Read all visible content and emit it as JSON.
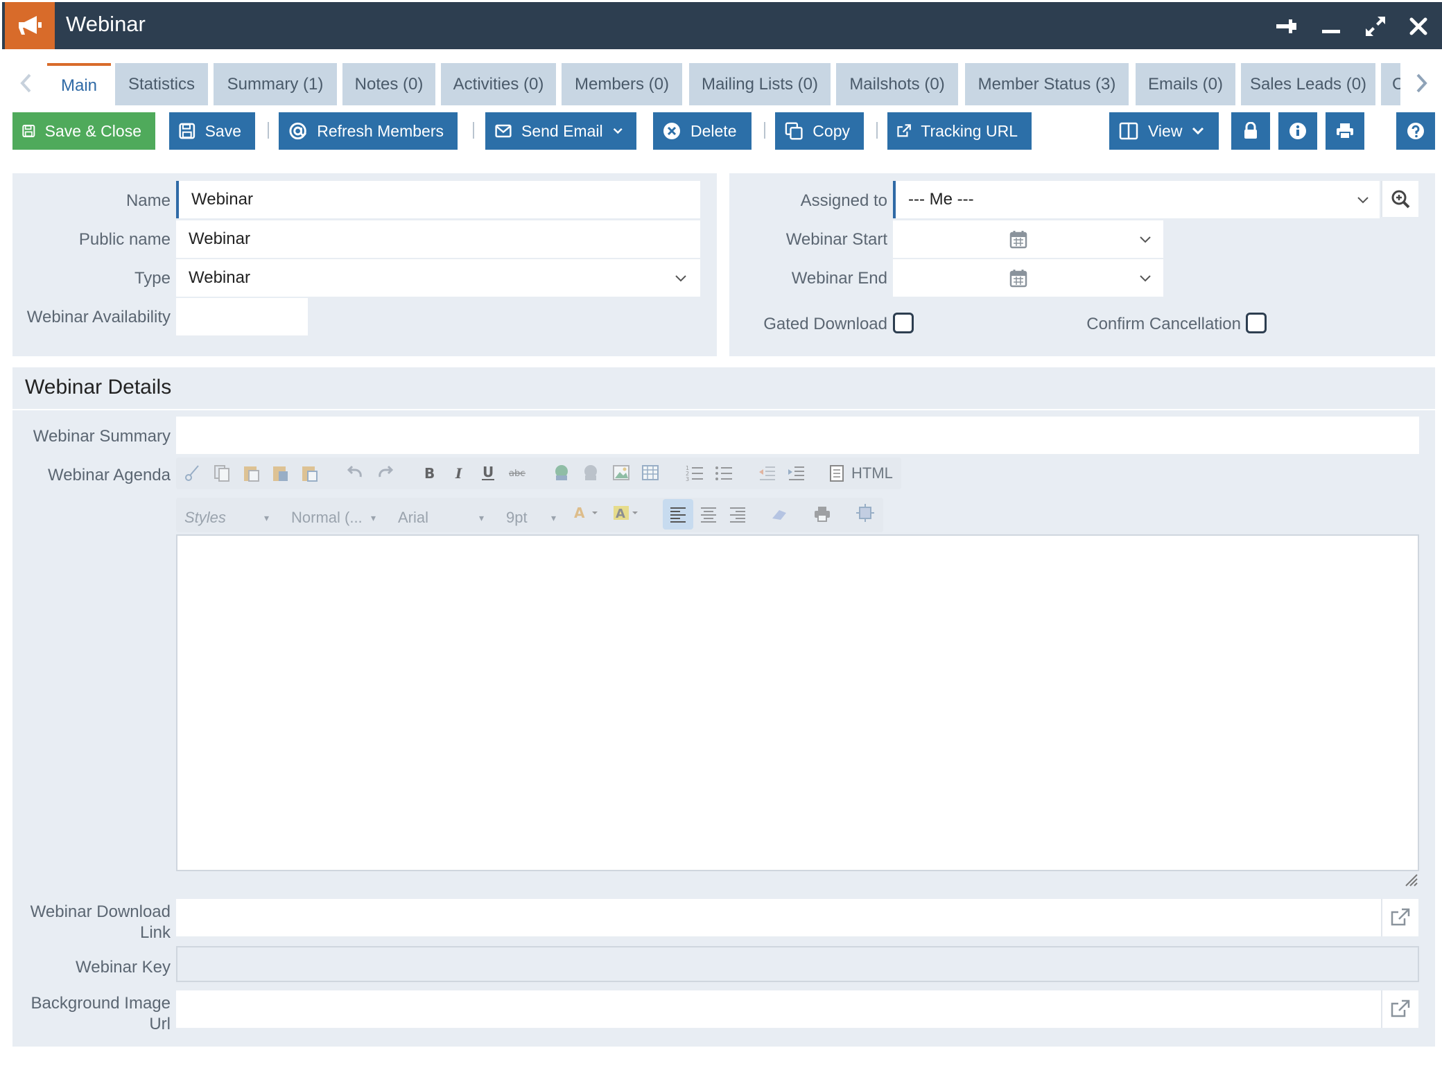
{
  "window": {
    "title": "Webinar",
    "app_icon": "megaphone-icon",
    "controls": [
      "pin-icon",
      "minimize-icon",
      "expand-icon",
      "close-icon"
    ]
  },
  "tabs": [
    {
      "label": "Main",
      "active": true
    },
    {
      "label": "Statistics"
    },
    {
      "label": "Summary (1)"
    },
    {
      "label": "Notes (0)"
    },
    {
      "label": "Activities (0)"
    },
    {
      "label": "Members (0)"
    },
    {
      "label": "Mailing Lists (0)"
    },
    {
      "label": "Mailshots (0)"
    },
    {
      "label": "Member Status (3)"
    },
    {
      "label": "Emails (0)"
    },
    {
      "label": "Sales Leads (0)"
    },
    {
      "label": "C"
    }
  ],
  "toolbar": {
    "save_close": "Save & Close",
    "save": "Save",
    "refresh_members": "Refresh Members",
    "send_email": "Send Email",
    "delete": "Delete",
    "copy": "Copy",
    "tracking_url": "Tracking URL",
    "view": "View"
  },
  "form": {
    "name_label": "Name",
    "name_value": "Webinar",
    "public_name_label": "Public name",
    "public_name_value": "Webinar",
    "type_label": "Type",
    "type_value": "Webinar",
    "availability_label": "Webinar Availability",
    "availability_value": "",
    "assigned_label": "Assigned to",
    "assigned_value": "--- Me ---",
    "start_label": "Webinar Start",
    "end_label": "Webinar End",
    "gated_label": "Gated Download",
    "confirm_label": "Confirm Cancellation"
  },
  "details": {
    "section_title": "Webinar Details",
    "summary_label": "Webinar Summary",
    "agenda_label": "Webinar Agenda",
    "download_label_1": "Webinar Download",
    "download_label_2": "Link",
    "key_label": "Webinar Key",
    "bg_label_1": "Background Image",
    "bg_label_2": "Url"
  },
  "editor": {
    "html_label": "HTML",
    "styles": "Styles",
    "format": "Normal (...",
    "font": "Arial",
    "size": "9pt"
  },
  "colors": {
    "titlebar": "#2d3e50",
    "accent": "#d86b2a",
    "primary": "#2c6fa8",
    "success": "#4faa5b",
    "tab": "#c8d6e3",
    "panel": "#e8edf3"
  }
}
